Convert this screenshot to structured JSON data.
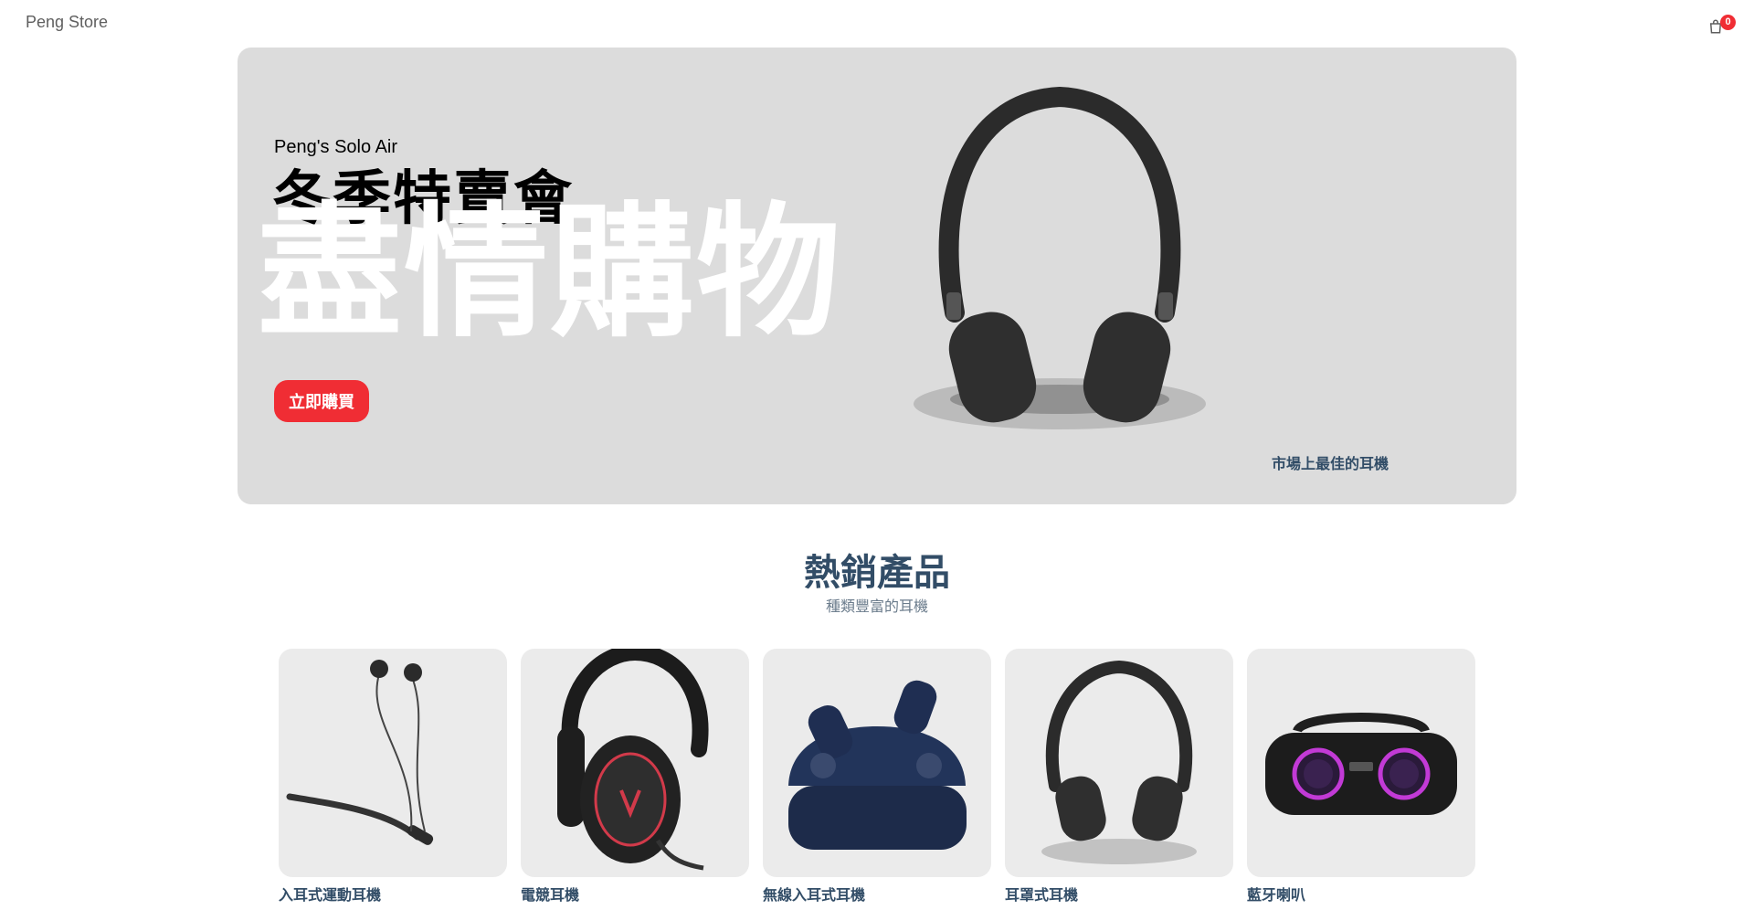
{
  "navbar": {
    "logo": "Peng Store",
    "cart_count": "0"
  },
  "hero": {
    "small_text": "Peng's Solo Air",
    "mid_text": "冬季特賣會",
    "large_text": "盡情購物",
    "button_label": "立即購買",
    "description": "市場上最佳的耳機"
  },
  "products_section": {
    "title": "熱銷產品",
    "subtitle": "種類豐富的耳機"
  },
  "products": [
    {
      "name": "入耳式運動耳機",
      "price": ""
    },
    {
      "name": "電競耳機",
      "price": ""
    },
    {
      "name": "無線入耳式耳機",
      "price": ""
    },
    {
      "name": "耳罩式耳機",
      "price": ""
    },
    {
      "name": "藍牙喇叭",
      "price": ""
    }
  ],
  "colors": {
    "accent": "#f02d34",
    "text": "#324d67",
    "hero_bg": "#dcdcdc",
    "card_bg": "#ebebeb"
  }
}
